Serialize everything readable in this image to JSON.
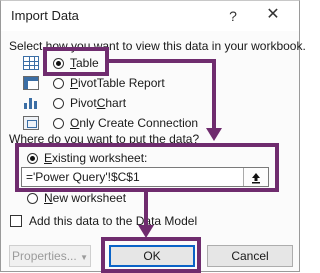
{
  "dialog": {
    "title": "Import Data",
    "help": "?",
    "close": "✕"
  },
  "view_section": {
    "label": "Select how you want to view this data in your workbook.",
    "options": [
      {
        "pre": "",
        "u": "T",
        "post": "able",
        "checked": true,
        "icon": "table-icon"
      },
      {
        "pre": "",
        "u": "P",
        "post": "ivotTable Report",
        "checked": false,
        "icon": "pivottable-icon"
      },
      {
        "pre": "Pivot",
        "u": "C",
        "post": "hart",
        "checked": false,
        "icon": "pivotchart-icon"
      },
      {
        "pre": "",
        "u": "O",
        "post": "nly Create Connection",
        "checked": false,
        "icon": "connection-icon"
      }
    ]
  },
  "location_section": {
    "label": "Where do you want to put the data?",
    "existing": {
      "pre": "",
      "u": "E",
      "post": "xisting worksheet:",
      "checked": true
    },
    "reference": "='Power Query'!$C$1",
    "new": {
      "pre": "",
      "u": "N",
      "post": "ew worksheet",
      "checked": false
    }
  },
  "data_model": {
    "label": "Add this data to the Data Model",
    "checked": false
  },
  "buttons": {
    "properties": "Properties...",
    "ok": "OK",
    "cancel": "Cancel"
  },
  "annotation_color": "#6f2c6e"
}
